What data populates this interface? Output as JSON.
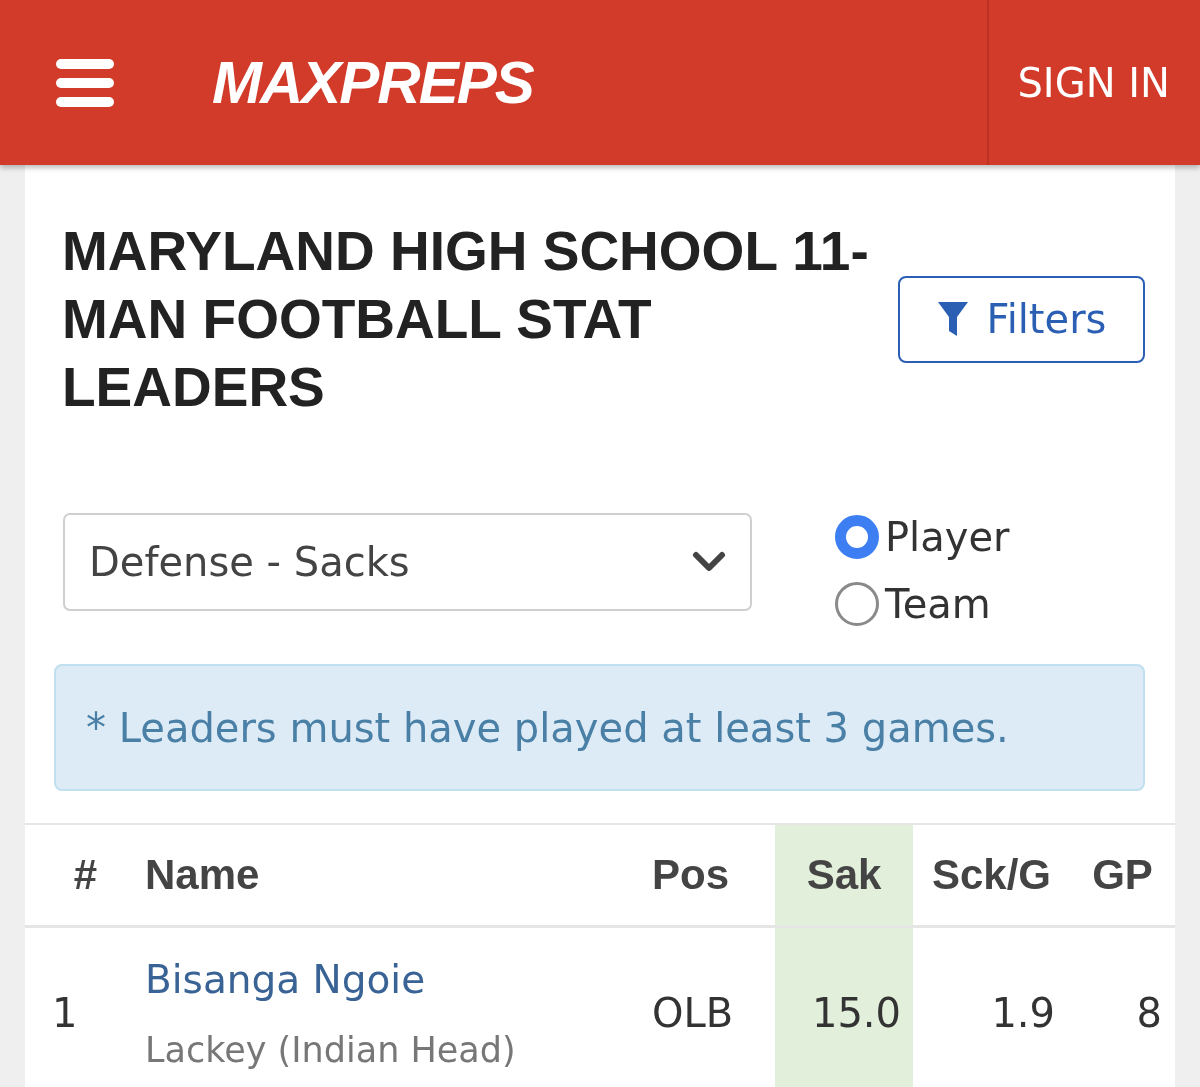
{
  "header": {
    "logo": "MAXPREPS",
    "sign_in": "SIGN IN"
  },
  "page_title": "MARYLAND HIGH SCHOOL 11-MAN FOOTBALL STAT LEADERS",
  "filters_button": {
    "label": "Filters"
  },
  "stat_select": {
    "value": "Defense - Sacks"
  },
  "view_options": [
    {
      "label": "Player",
      "selected": true
    },
    {
      "label": "Team",
      "selected": false
    }
  ],
  "notice": "* Leaders must have played at least 3 games.",
  "table": {
    "columns": [
      {
        "label": "#",
        "sorted": false
      },
      {
        "label": "Name",
        "sorted": false
      },
      {
        "label": "Pos",
        "sorted": false
      },
      {
        "label": "Sak",
        "sorted": true
      },
      {
        "label": "Sck/G",
        "sorted": false
      },
      {
        "label": "GP",
        "sorted": false
      }
    ],
    "rows": [
      {
        "rank": "1",
        "name": "Bisanga Ngoie",
        "school": "Lackey (Indian Head)",
        "position": "OLB",
        "sacks": "15.0",
        "sacks_per_game": "1.9",
        "games_played": "8"
      }
    ]
  }
}
